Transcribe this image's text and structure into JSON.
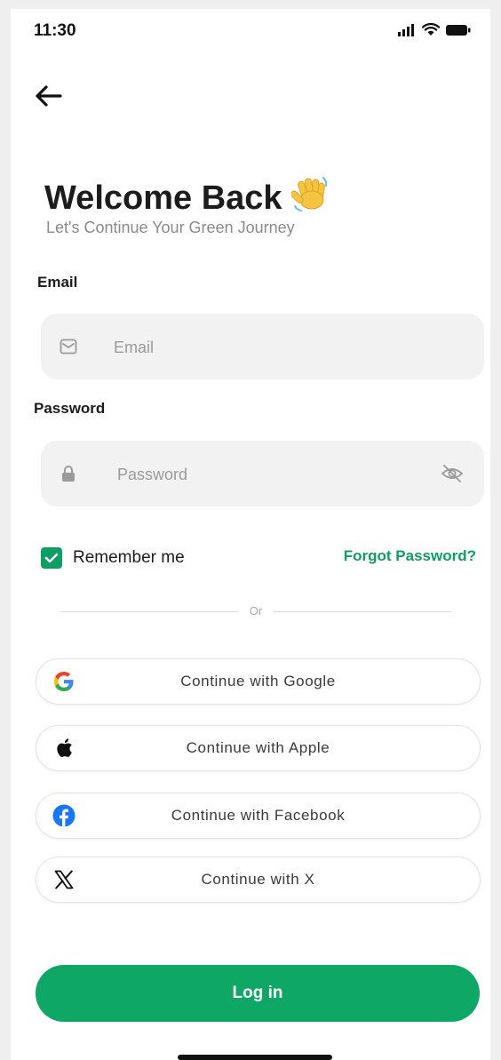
{
  "status_bar": {
    "time": "11:30"
  },
  "header": {
    "title": "Welcome Back",
    "title_emoji": "👋",
    "subtitle": "Let's Continue Your Green Journey"
  },
  "form": {
    "email_label": "Email",
    "email_placeholder": "Email",
    "password_label": "Password",
    "password_placeholder": "Password",
    "remember_label": "Remember me",
    "remember_checked": true,
    "forgot_label": "Forgot Password?"
  },
  "divider": {
    "text": "Or"
  },
  "social": [
    {
      "label": "Continue with Google",
      "icon": "google-icon"
    },
    {
      "label": "Continue with Apple",
      "icon": "apple-icon"
    },
    {
      "label": "Continue with Facebook",
      "icon": "facebook-icon"
    },
    {
      "label": "Continue with X",
      "icon": "x-icon"
    }
  ],
  "login": {
    "label": "Log in"
  },
  "colors": {
    "brand_green": "#0ea765",
    "link_green": "#0e9e63",
    "input_bg": "#f2f2f2",
    "facebook_blue": "#1877f2"
  }
}
